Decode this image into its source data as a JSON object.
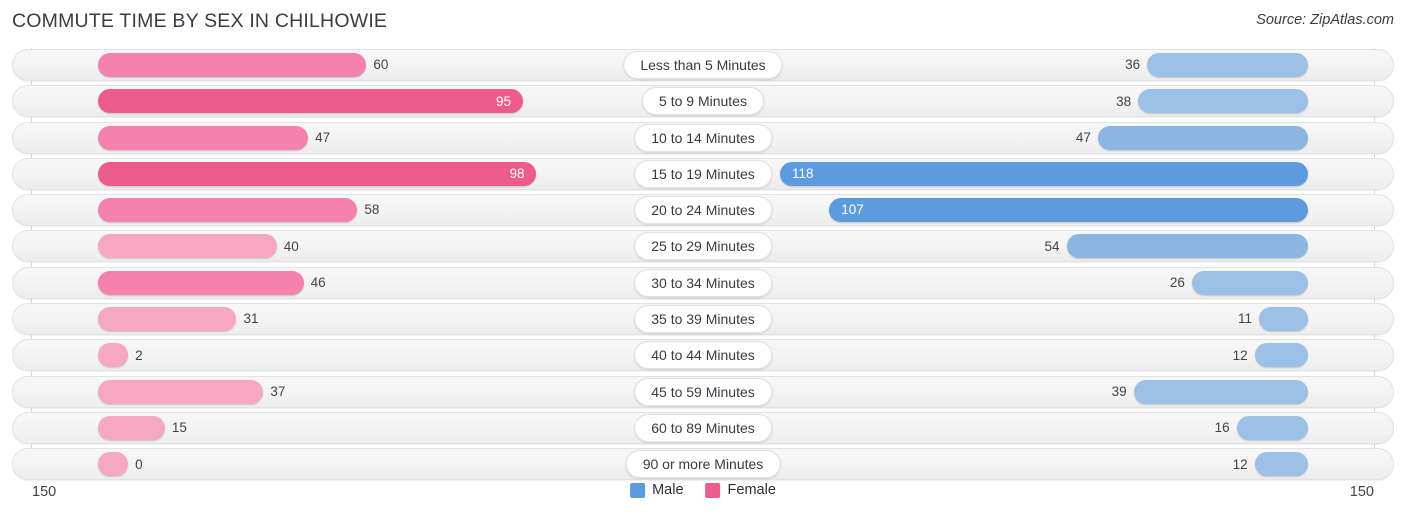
{
  "header": {
    "title": "COMMUTE TIME BY SEX IN CHILHOWIE",
    "source": "Source: ZipAtlas.com"
  },
  "footer": {
    "axis_left": "150",
    "axis_right": "150",
    "legend": [
      {
        "label": "Male",
        "color": "#5B9BDE"
      },
      {
        "label": "Female",
        "color": "#EE5C8D"
      }
    ]
  },
  "colors": {
    "male_light": "#9CC0E6",
    "male_mid": "#8BB6E2",
    "male_dark": "#5B9BDE",
    "female_light": "#F6A8C3",
    "female_mid": "#F482AC",
    "female_dark": "#EE5C8D",
    "track": "#F3F3F3",
    "gridline": "#D8D8D8",
    "text": "#43434D"
  },
  "chart_data": {
    "type": "bar",
    "subtype": "diverging-bidirectional",
    "title": "COMMUTE TIME BY SEX IN CHILHOWIE",
    "xlabel": "",
    "ylabel": "",
    "xlim": [
      150,
      150
    ],
    "axis_max": 150,
    "grid": true,
    "legend_position": "bottom-center",
    "categories": [
      "Less than 5 Minutes",
      "5 to 9 Minutes",
      "10 to 14 Minutes",
      "15 to 19 Minutes",
      "20 to 24 Minutes",
      "25 to 29 Minutes",
      "30 to 34 Minutes",
      "35 to 39 Minutes",
      "40 to 44 Minutes",
      "45 to 59 Minutes",
      "60 to 89 Minutes",
      "90 or more Minutes"
    ],
    "series": [
      {
        "name": "Male",
        "color": "#5B9BDE",
        "values": [
          36,
          38,
          47,
          118,
          107,
          54,
          26,
          11,
          12,
          39,
          16,
          12
        ]
      },
      {
        "name": "Female",
        "color": "#EE5C8D",
        "values": [
          60,
          95,
          47,
          98,
          58,
          40,
          46,
          31,
          2,
          37,
          15,
          0
        ]
      }
    ]
  },
  "rows": [
    {
      "category": "Less than 5 Minutes",
      "male": 36,
      "male_text": "36",
      "female": 60,
      "female_text": "60"
    },
    {
      "category": "5 to 9 Minutes",
      "male": 38,
      "male_text": "38",
      "female": 95,
      "female_text": "95"
    },
    {
      "category": "10 to 14 Minutes",
      "male": 47,
      "male_text": "47",
      "female": 47,
      "female_text": "47"
    },
    {
      "category": "15 to 19 Minutes",
      "male": 118,
      "male_text": "118",
      "female": 98,
      "female_text": "98"
    },
    {
      "category": "20 to 24 Minutes",
      "male": 107,
      "male_text": "107",
      "female": 58,
      "female_text": "58"
    },
    {
      "category": "25 to 29 Minutes",
      "male": 54,
      "male_text": "54",
      "female": 40,
      "female_text": "40"
    },
    {
      "category": "30 to 34 Minutes",
      "male": 26,
      "male_text": "26",
      "female": 46,
      "female_text": "46"
    },
    {
      "category": "35 to 39 Minutes",
      "male": 11,
      "male_text": "11",
      "female": 31,
      "female_text": "31"
    },
    {
      "category": "40 to 44 Minutes",
      "male": 12,
      "male_text": "12",
      "female": 2,
      "female_text": "2"
    },
    {
      "category": "45 to 59 Minutes",
      "male": 39,
      "male_text": "39",
      "female": 37,
      "female_text": "37"
    },
    {
      "category": "60 to 89 Minutes",
      "male": 16,
      "male_text": "16",
      "female": 15,
      "female_text": "15"
    },
    {
      "category": "90 or more Minutes",
      "male": 12,
      "male_text": "12",
      "female": 0,
      "female_text": "0"
    }
  ]
}
